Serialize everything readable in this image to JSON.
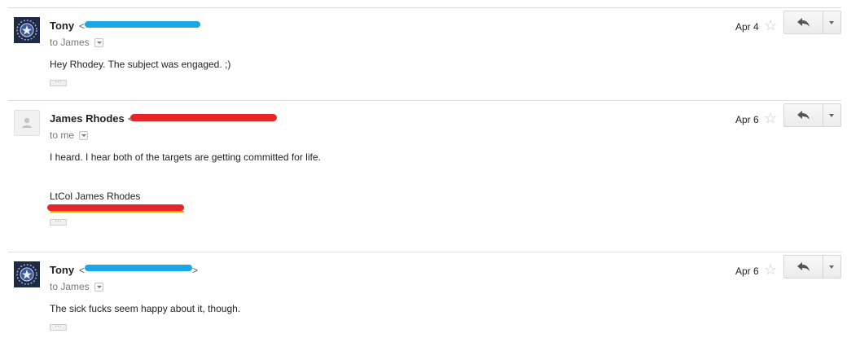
{
  "messages": [
    {
      "sender": "Tony",
      "email_open": "<",
      "to_line": "to James",
      "date": "Apr 4",
      "body": [
        "Hey Rhodey.  The subject was engaged.  ;)"
      ],
      "redaction_color": "#1aa7e6"
    },
    {
      "sender": "James Rhodes",
      "email_open": "<",
      "to_line": "to me",
      "date": "Apr 6",
      "body": [
        "I heard.  I hear both of the targets are getting committed for life."
      ],
      "signature": "LtCol James Rhodes",
      "redaction_color": "#e8262a"
    },
    {
      "sender": "Tony",
      "email_open": "<",
      "email_close": ">",
      "to_line": "to James",
      "date": "Apr 6",
      "body": [
        "The sick fucks seem happy about it, though."
      ],
      "redaction_color": "#1aa7e6"
    }
  ],
  "icons": {
    "star": "star-icon",
    "reply": "reply-icon",
    "more": "chevron-down-icon",
    "ellipsis": "ellipsis-icon"
  },
  "ellipsis_label": "···"
}
